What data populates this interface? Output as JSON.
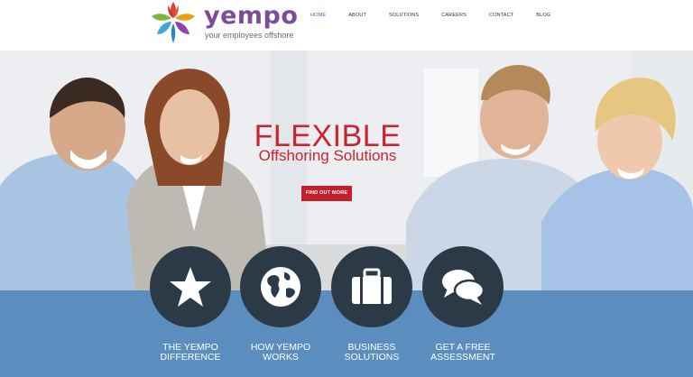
{
  "brand": {
    "name": "yempo",
    "tagline": "your employees offshore",
    "logo_icon": "leaf-flower-icon",
    "colors": {
      "logo_text": "#7c4c9b",
      "accent_red": "#c72631",
      "band_blue": "#5b8ebf",
      "circle_dark": "#2b3a46",
      "nav_active": "#8e44ad"
    }
  },
  "nav": {
    "items": [
      {
        "label": "HOME",
        "active": true
      },
      {
        "label": "ABOUT",
        "active": false
      },
      {
        "label": "SOLUTIONS",
        "active": false
      },
      {
        "label": "CAREERS",
        "active": false
      },
      {
        "label": "CONTACT",
        "active": false
      },
      {
        "label": "BLOG",
        "active": false
      }
    ]
  },
  "hero": {
    "title": "FLEXIBLE",
    "subtitle": "Offshoring Solutions",
    "cta_label": "FIND OUT MORE"
  },
  "features": [
    {
      "line1": "THE YEMPO",
      "line2": "DIFFERENCE",
      "icon": "star-icon"
    },
    {
      "line1": "HOW YEMPO",
      "line2": "WORKS",
      "icon": "globe-icon"
    },
    {
      "line1": "BUSINESS",
      "line2": "SOLUTIONS",
      "icon": "briefcase-icon"
    },
    {
      "line1": "GET A FREE",
      "line2": "ASSESSMENT",
      "icon": "chat-bubbles-icon"
    }
  ]
}
